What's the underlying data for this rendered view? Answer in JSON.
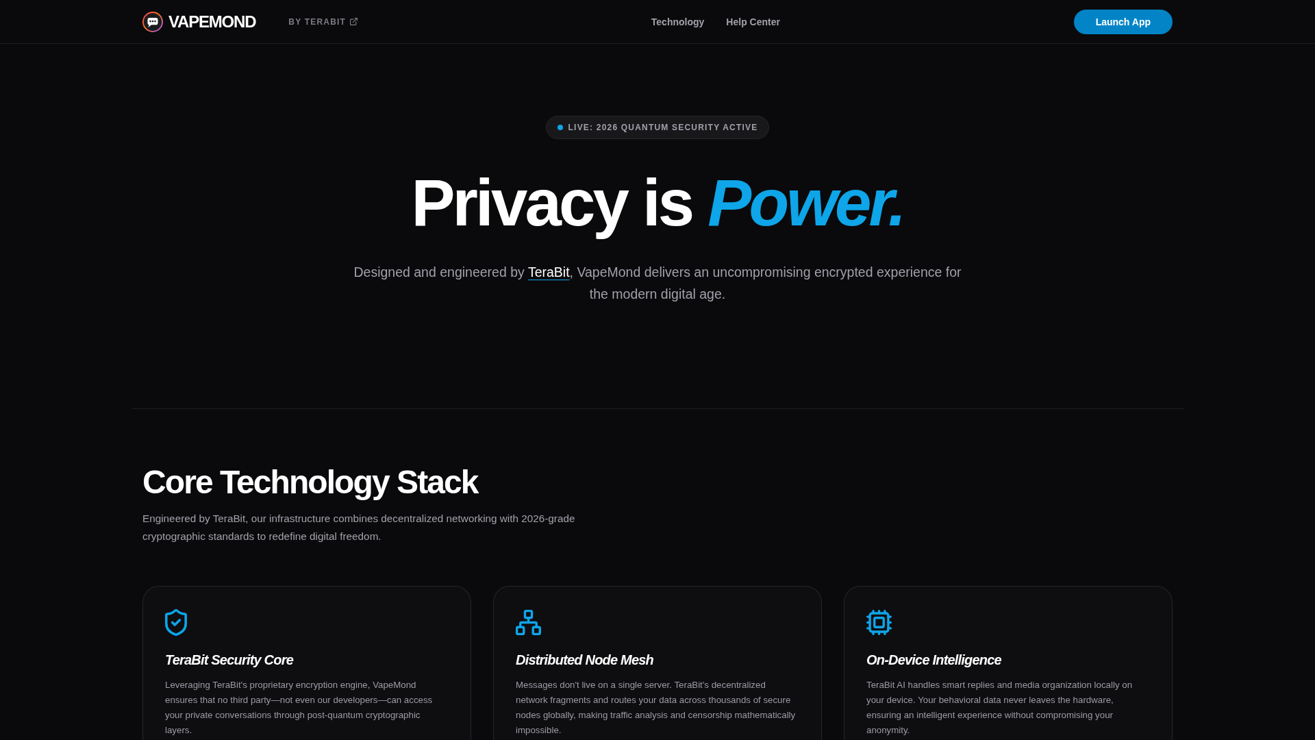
{
  "header": {
    "brand": "VAPEMOND",
    "byline": "BY TERABIT",
    "nav": [
      "Technology",
      "Help Center"
    ],
    "cta": "Launch App"
  },
  "hero": {
    "badge": "LIVE: 2026 QUANTUM SECURITY ACTIVE",
    "title": "Privacy is",
    "title_accent": "Power.",
    "subtitle_before": "Designed and engineered by ",
    "subtitle_link": "TeraBit",
    "subtitle_after": ", VapeMond delivers an uncompromising encrypted experience for the modern digital age."
  },
  "technology": {
    "title": "Core Technology Stack",
    "description": "Engineered by TeraBit, our infrastructure combines decentralized networking with 2026-grade cryptographic standards to redefine digital freedom.",
    "cards": [
      {
        "title": "TeraBit Security Core",
        "description": "Leveraging TeraBit's proprietary encryption engine, VapeMond ensures that no third party—not even our developers—can access your private conversations through post-quantum cryptographic layers."
      },
      {
        "title": "Distributed Node Mesh",
        "description": "Messages don't live on a single server. TeraBit's decentralized network fragments and routes your data across thousands of secure nodes globally, making traffic analysis and censorship mathematically impossible."
      },
      {
        "title": "On-Device Intelligence",
        "description": "TeraBit AI handles smart replies and media organization locally on your device. Your behavioral data never leaves the hardware, ensuring an intelligent experience without compromising your anonymity."
      }
    ]
  }
}
